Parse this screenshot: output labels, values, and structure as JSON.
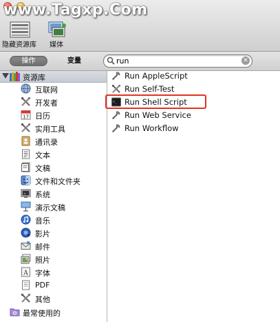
{
  "watermark": "www.Tagxp.Com",
  "toolbar": {
    "hide_library_label": "隐藏资源库",
    "media_label": "媒体"
  },
  "filterbar": {
    "actions_label": "操作",
    "variables_label": "变量",
    "search_value": "run"
  },
  "library": {
    "header": "资源库",
    "items": [
      {
        "label": "互联网",
        "icon": "globe-icon"
      },
      {
        "label": "开发者",
        "icon": "tools-icon"
      },
      {
        "label": "日历",
        "icon": "calendar-icon"
      },
      {
        "label": "实用工具",
        "icon": "tools-icon"
      },
      {
        "label": "通讯录",
        "icon": "address-book-icon"
      },
      {
        "label": "文本",
        "icon": "text-icon"
      },
      {
        "label": "文稿",
        "icon": "document-icon"
      },
      {
        "label": "文件和文件夹",
        "icon": "finder-icon"
      },
      {
        "label": "系统",
        "icon": "system-icon"
      },
      {
        "label": "演示文稿",
        "icon": "presentation-icon"
      },
      {
        "label": "音乐",
        "icon": "music-icon"
      },
      {
        "label": "影片",
        "icon": "movie-icon"
      },
      {
        "label": "邮件",
        "icon": "mail-icon"
      },
      {
        "label": "照片",
        "icon": "photo-icon"
      },
      {
        "label": "字体",
        "icon": "font-icon"
      },
      {
        "label": "PDF",
        "icon": "pdf-icon"
      },
      {
        "label": "其他",
        "icon": "tools-icon"
      }
    ],
    "favorites": [
      {
        "label": "最常使用的",
        "icon": "smart-folder-icon"
      }
    ]
  },
  "results": [
    {
      "label": "Run AppleScript",
      "icon": "script-icon"
    },
    {
      "label": "Run Self-Test",
      "icon": "tools-icon"
    },
    {
      "label": "Run Shell Script",
      "icon": "terminal-icon",
      "highlighted": true
    },
    {
      "label": "Run Web Service",
      "icon": "script-icon"
    },
    {
      "label": "Run Workflow",
      "icon": "script-icon"
    }
  ],
  "colors": {
    "highlight_border": "#e2321f",
    "segment_selected": "#7a7a7a"
  }
}
